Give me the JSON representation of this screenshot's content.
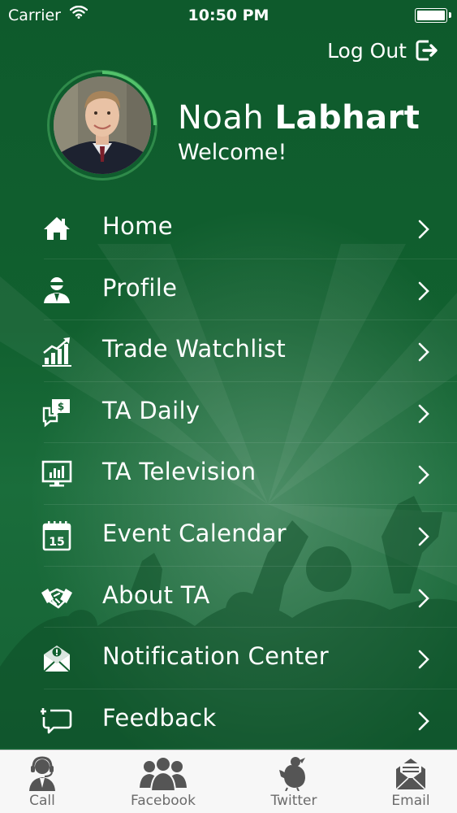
{
  "status_bar": {
    "carrier": "Carrier",
    "time": "10:50 PM"
  },
  "header": {
    "logout_label": "Log Out"
  },
  "user": {
    "first_name": "Noah",
    "last_name": "Labhart",
    "greeting": "Welcome!"
  },
  "menu": {
    "items": [
      {
        "label": "Home",
        "icon": "home-icon"
      },
      {
        "label": "Profile",
        "icon": "profile-icon"
      },
      {
        "label": "Trade Watchlist",
        "icon": "chart-growth-icon"
      },
      {
        "label": "TA Daily",
        "icon": "chat-dollar-icon"
      },
      {
        "label": "TA Television",
        "icon": "monitor-chart-icon"
      },
      {
        "label": "Event Calendar",
        "icon": "calendar-icon"
      },
      {
        "label": "About TA",
        "icon": "handshake-icon"
      },
      {
        "label": "Notification Center",
        "icon": "envelope-alert-icon"
      },
      {
        "label": "Feedback",
        "icon": "feedback-icon"
      }
    ]
  },
  "tabbar": {
    "tabs": [
      {
        "label": "Call",
        "icon": "call-agent-icon"
      },
      {
        "label": "Facebook",
        "icon": "group-icon"
      },
      {
        "label": "Twitter",
        "icon": "bird-icon"
      },
      {
        "label": "Email",
        "icon": "email-icon"
      }
    ]
  },
  "colors": {
    "background": "#11602f",
    "ring": "#2f8a4a",
    "tabbar": "#f7f7f7",
    "tab_icon": "#555555"
  }
}
